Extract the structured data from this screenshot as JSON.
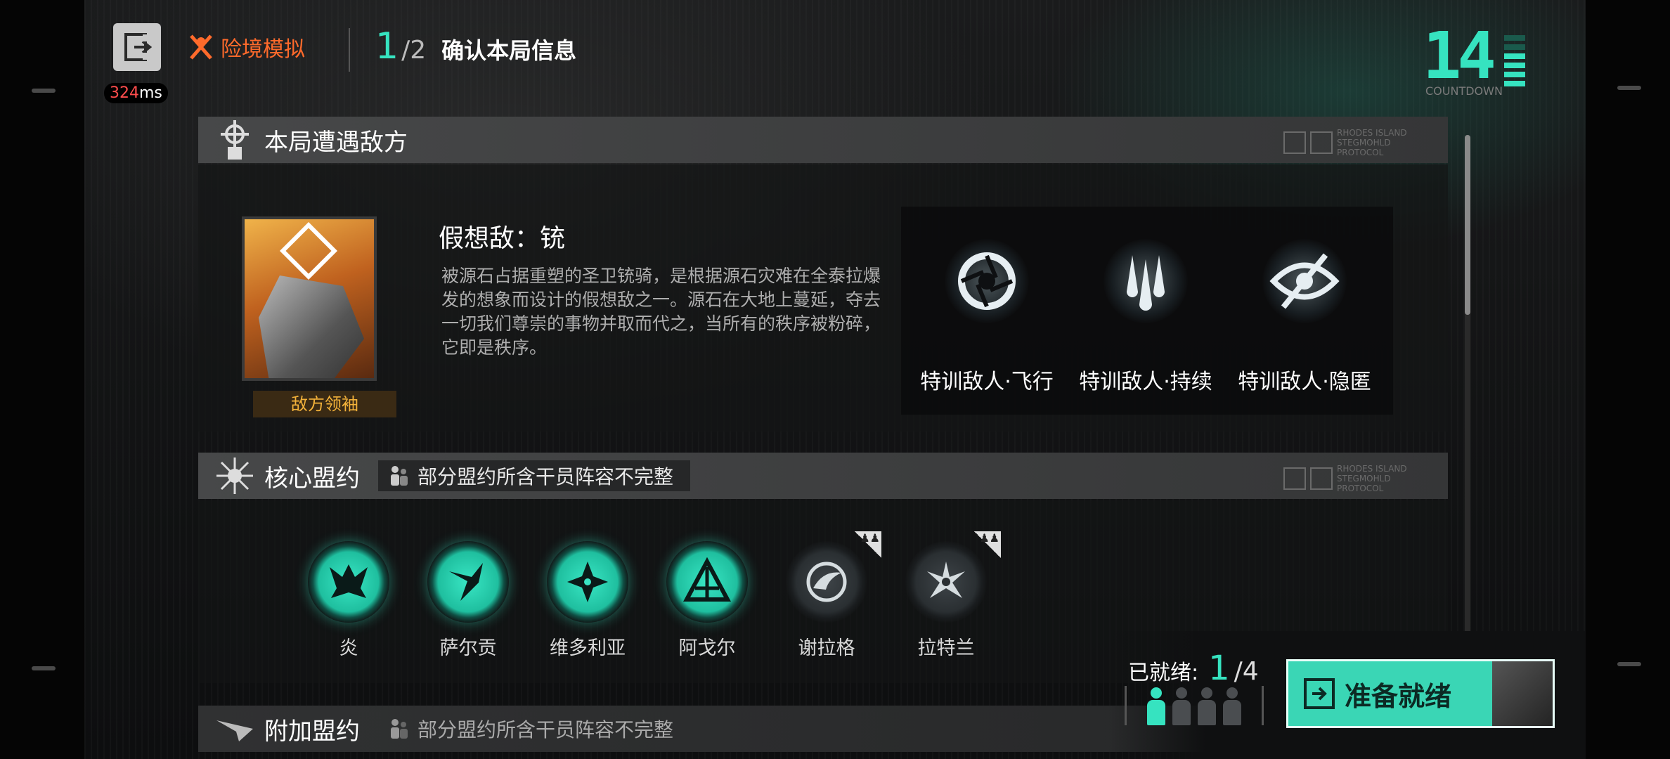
{
  "topbar": {
    "ping_value": "324",
    "ping_unit": "ms",
    "mode_label": "险境模拟",
    "step_current": "1",
    "step_total": "/2",
    "step_title": "确认本局信息",
    "countdown_value": "14",
    "countdown_label": "COUNTDOWN"
  },
  "enemy_section": {
    "title": "本局遭遇敌方",
    "logo_text": "RHODES ISLAND STEGMOHLD PROTOCOL",
    "boss_name": "假想敌：铳",
    "boss_tag": "敌方领袖",
    "boss_desc": "被源石占据重塑的圣卫铳骑，是根据源石灾难在全泰拉爆发的想象而设计的假想敌之一。源石在大地上蔓延，夺去一切我们尊崇的事物并取而代之，当所有的秩序被粉碎，它即是秩序。",
    "traits": [
      {
        "icon": "aperture-icon",
        "label": "特训敌人·飞行"
      },
      {
        "icon": "drops-icon",
        "label": "特训敌人·持续"
      },
      {
        "icon": "hidden-eye-icon",
        "label": "特训敌人·隐匿"
      }
    ]
  },
  "core_section": {
    "title": "核心盟约",
    "warning": "部分盟约所含干员阵容不完整",
    "logo_text": "RHODES ISLAND STEGMOHLD PROTOCOL",
    "alliances": [
      {
        "name": "炎",
        "active": true,
        "badge": false
      },
      {
        "name": "萨尔贡",
        "active": true,
        "badge": false
      },
      {
        "name": "维多利亚",
        "active": true,
        "badge": false
      },
      {
        "name": "阿戈尔",
        "active": true,
        "badge": false
      },
      {
        "name": "谢拉格",
        "active": false,
        "badge": true
      },
      {
        "name": "拉特兰",
        "active": false,
        "badge": true
      }
    ]
  },
  "extra_section": {
    "title": "附加盟约",
    "warning": "部分盟约所含干员阵容不完整"
  },
  "ready": {
    "label": "已就绪:",
    "current": "1",
    "total": "/4",
    "players_ready": 1,
    "players_total": 4,
    "button_label": "准备就绪"
  },
  "colors": {
    "accent": "#36e3c0",
    "warning_orange": "#ff6a2b",
    "boss_tag": "#f3b23a",
    "ping_red": "#ff4d4d"
  }
}
